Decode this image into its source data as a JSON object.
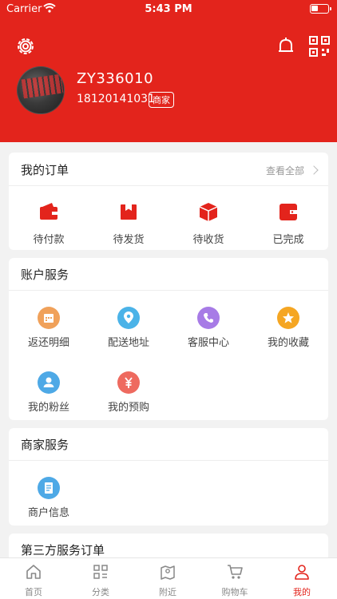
{
  "status_bar": {
    "carrier": "Carrier",
    "time": "5:43 PM"
  },
  "profile": {
    "username": "ZY336010",
    "phone": "18120141031",
    "badge": "商家"
  },
  "orders": {
    "title": "我的订单",
    "view_all": "查看全部",
    "items": [
      {
        "label": "待付款",
        "icon": "wallet-icon"
      },
      {
        "label": "待发货",
        "icon": "package-icon"
      },
      {
        "label": "待收货",
        "icon": "box-icon"
      },
      {
        "label": "已完成",
        "icon": "wallet-done-icon"
      }
    ]
  },
  "account": {
    "title": "账户服务",
    "items": [
      {
        "label": "返还明细",
        "icon": "calendar-icon",
        "color": "#f0a15a"
      },
      {
        "label": "配送地址",
        "icon": "location-icon",
        "color": "#4bb3e8"
      },
      {
        "label": "客服中心",
        "icon": "phone-icon",
        "color": "#a77be6"
      },
      {
        "label": "我的收藏",
        "icon": "star-icon",
        "color": "#f5a623"
      },
      {
        "label": "我的粉丝",
        "icon": "fans-icon",
        "color": "#4ea9e6"
      },
      {
        "label": "我的预购",
        "icon": "yen-icon",
        "color": "#ee6a5f"
      }
    ]
  },
  "merchant": {
    "title": "商家服务",
    "items": [
      {
        "label": "商户信息",
        "icon": "document-icon",
        "color": "#4ea9e6"
      }
    ]
  },
  "third_party": {
    "title": "第三方服务订单"
  },
  "tabbar": {
    "items": [
      {
        "label": "首页",
        "icon": "home-icon"
      },
      {
        "label": "分类",
        "icon": "category-icon"
      },
      {
        "label": "附近",
        "icon": "map-icon"
      },
      {
        "label": "购物车",
        "icon": "cart-icon"
      },
      {
        "label": "我的",
        "icon": "user-icon",
        "active": true
      }
    ]
  },
  "colors": {
    "brand": "#e3241c",
    "background": "#f2f2f2"
  }
}
